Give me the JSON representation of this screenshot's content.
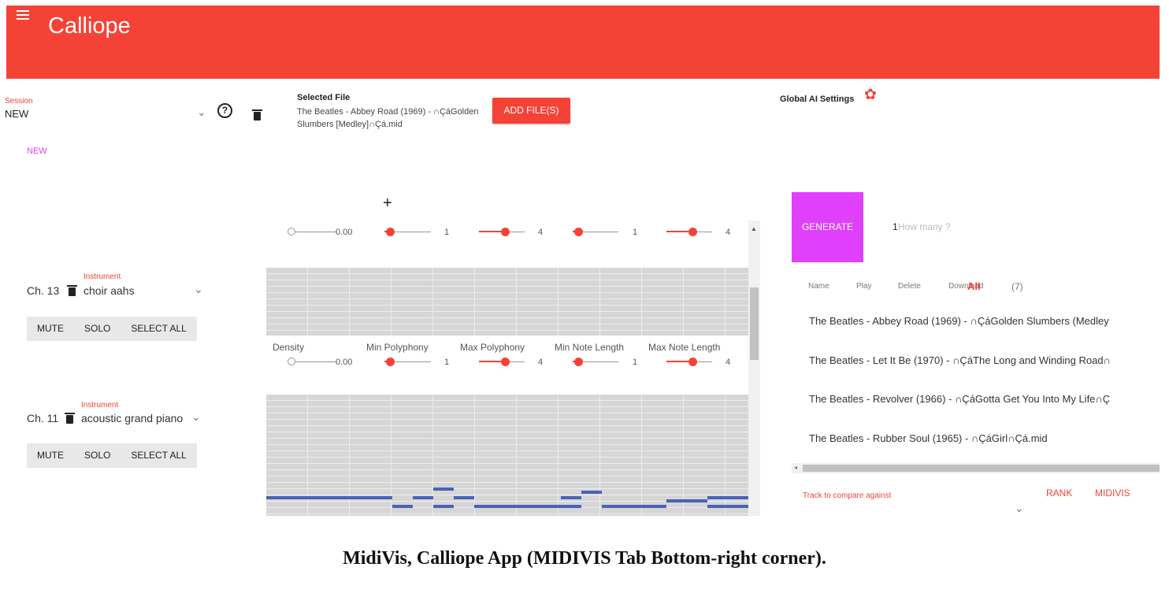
{
  "app": {
    "title": "Calliope"
  },
  "session": {
    "label": "Session",
    "value": "NEW",
    "tag": "NEW"
  },
  "selected_file": {
    "label": "Selected File",
    "name": "The Beatles - Abbey Road (1969) - ∩ÇáGolden Slumbers [Medley]∩Çá.mid"
  },
  "buttons": {
    "add_files": "ADD FILE(S)",
    "generate": "GENERATE",
    "rank": "RANK",
    "midivis": "MIDIVIS"
  },
  "global_ai": {
    "label": "Global AI Settings"
  },
  "channels": [
    {
      "channel": "Ch. 13",
      "instrument_label": "Instrument",
      "instrument": "choir aahs",
      "buttons": [
        "MUTE",
        "SOLO",
        "SELECT ALL"
      ]
    },
    {
      "channel": "Ch. 11",
      "instrument_label": "Instrument",
      "instrument": "acoustic grand piano",
      "buttons": [
        "MUTE",
        "SOLO",
        "SELECT ALL"
      ]
    }
  ],
  "params": {
    "labels": [
      "Density",
      "Min Polyphony",
      "Max Polyphony",
      "Min Note Length",
      "Max Note Length"
    ],
    "values": [
      "0.00",
      "1",
      "4",
      "1",
      "4"
    ]
  },
  "generate": {
    "count": "1",
    "placeholder": "How many ?"
  },
  "file_table": {
    "headers": [
      "Name",
      "Play",
      "Delete",
      "Download"
    ],
    "all_label": "All",
    "count": "(7)",
    "rows": [
      "The Beatles - Abbey Road (1969) - ∩ÇáGolden Slumbers (Medley",
      "The Beatles - Let It Be (1970) - ∩ÇáThe Long and Winding Road∩",
      "The Beatles - Revolver (1966) - ∩ÇáGotta Get You Into My Life∩Ç",
      "The Beatles - Rubber Soul (1965) - ∩ÇáGirl∩Çá.mid"
    ]
  },
  "compare": {
    "label": "Track to compare against"
  },
  "caption": "MidiVis, Calliope App (MIDIVIS Tab Bottom-right corner).",
  "icons": {
    "menu": "menu-icon",
    "help": "help-circle-icon",
    "trash": "trash-icon",
    "gear": "gear-icon",
    "plus": "plus-icon",
    "chevron": "chevron-down-icon"
  },
  "colors": {
    "primary": "#f44336",
    "accent": "#e040fb",
    "note": "#4a63b5"
  }
}
